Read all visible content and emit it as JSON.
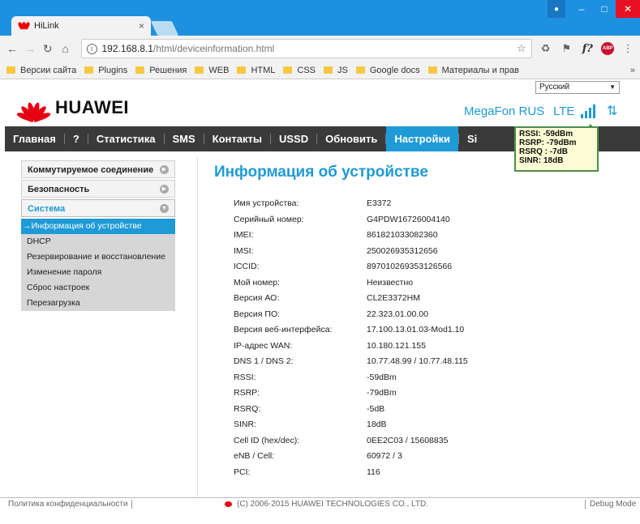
{
  "browser": {
    "tab_title": "HiLink",
    "tab_close": "×",
    "url_host": "192.168.8.1",
    "url_path": "/html/deviceinformation.html",
    "bookmarks": [
      "Версии сайта",
      "Plugins",
      "Решения",
      "WEB",
      "HTML",
      "CSS",
      "JS",
      "Google docs",
      "Материалы и прав"
    ],
    "bookmarks_more": "»"
  },
  "header": {
    "language": "Русский",
    "brand": "HUAWEI",
    "operator": "MegaFon RUS",
    "network_type": "LTE",
    "signal_bars": 4,
    "brand_color": "#e60012",
    "accent_color": "#1e9ad6"
  },
  "menu": [
    "Главная",
    "?",
    "Статистика",
    "SMS",
    "Контакты",
    "USSD",
    "Обновить",
    "Настройки",
    "Si"
  ],
  "menu_active": 7,
  "tooltip": {
    "rssi": "RSSI: -59dBm",
    "rsrp": "RSRP: -79dBm",
    "rsrq": "RSRQ : -7dB",
    "sinr": "SINR: 18dB"
  },
  "sidebar": {
    "groups": [
      "Коммутируемое соединение",
      "Безопасность",
      "Система"
    ],
    "items": [
      "→Информация об устройстве",
      "DHCP",
      "Резервирование и восстановление",
      "Изменение пароля",
      "Сброс настроек",
      "Перезагрузка"
    ]
  },
  "content": {
    "title": "Информация об устройстве",
    "rows": [
      [
        "Имя устройства:",
        "E3372"
      ],
      [
        "Серийный номер:",
        "G4PDW16726004140"
      ],
      [
        "IMEI:",
        "861821033082360"
      ],
      [
        "IMSI:",
        "250026935312656"
      ],
      [
        "ICCID:",
        "897010269353126566"
      ],
      [
        "Мой номер:",
        "Неизвестно"
      ],
      [
        "Версия АО:",
        "CL2E3372HM"
      ],
      [
        "Версия ПО:",
        "22.323.01.00.00"
      ],
      [
        "Версия веб-интерфейса:",
        "17.100.13.01.03-Mod1.10"
      ],
      [
        "IP-адрес WAN:",
        "10.180.121.155"
      ],
      [
        "DNS 1 / DNS 2:",
        "10.77.48.99 / 10.77.48.115"
      ],
      [
        "RSSI:",
        "-59dBm"
      ],
      [
        "RSRP:",
        "-79dBm"
      ],
      [
        "RSRQ:",
        "-5dB"
      ],
      [
        "SINR:",
        "18dB"
      ],
      [
        "Cell ID (hex/dec):",
        "0EE2C03 / 15608835"
      ],
      [
        "eNB / Cell:",
        "60972 / 3"
      ],
      [
        "PCI:",
        "116"
      ]
    ]
  },
  "footer": {
    "privacy": "Политика конфиденциальности",
    "copyright": "(C) 2006-2015 HUAWEI TECHNOLOGIES CO., LTD.",
    "debug": "Debug Mode"
  }
}
